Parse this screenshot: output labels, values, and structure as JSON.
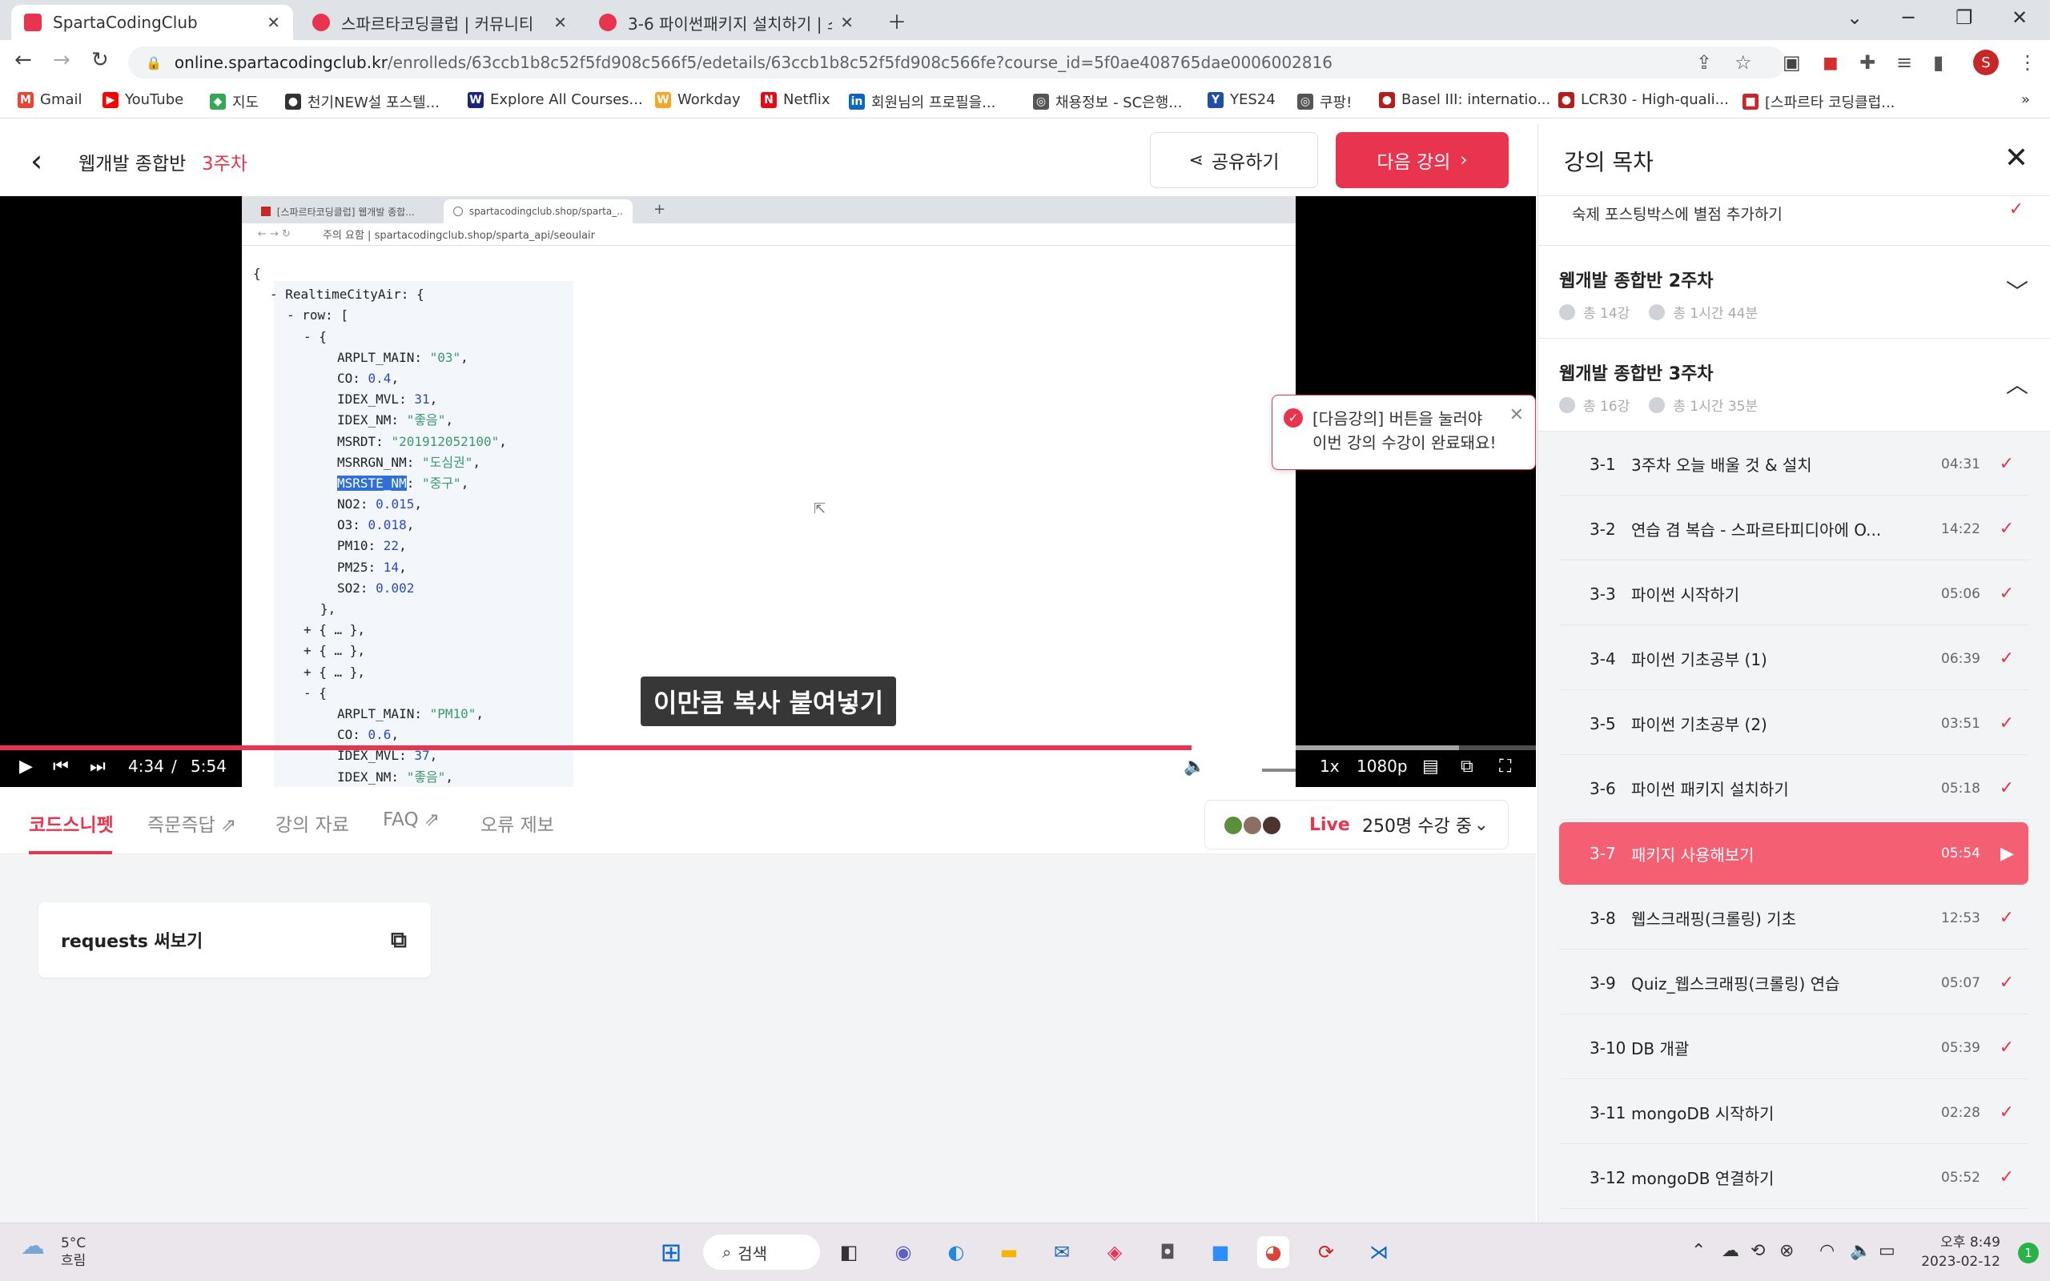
{
  "browser": {
    "tabs": [
      {
        "title": "SpartaCodingClub",
        "color": "#e8344e"
      },
      {
        "title": "스파르타코딩클럽 | 커뮤니티",
        "color": "#e8344e"
      },
      {
        "title": "3-6 파이썬패키지 설치하기 | 스파",
        "color": "#e8344e"
      }
    ],
    "url_host": "online.spartacodingclub.kr",
    "url_path": "/enrolleds/63ccb1b8c52f5fd908c566f5/edetails/63ccb1b8c52f5fd908c566fe?course_id=5f0ae408765dae0006002816",
    "profile_letter": "S"
  },
  "bookmarks": [
    {
      "label": "Gmail",
      "icon": "gmail-icon",
      "color": "#ea4335",
      "glyph": "M"
    },
    {
      "label": "YouTube",
      "icon": "youtube-icon",
      "color": "#ff0000",
      "glyph": "▶"
    },
    {
      "label": "지도",
      "icon": "maps-icon",
      "color": "#34a853",
      "glyph": "◆"
    },
    {
      "label": "천기NEW설 포스텔...",
      "icon": "globe-icon",
      "color": "#333333",
      "glyph": "●"
    },
    {
      "label": "Explore All Courses...",
      "icon": "course-icon",
      "color": "#1a237e",
      "glyph": "W"
    },
    {
      "label": "Workday",
      "icon": "workday-icon",
      "color": "#f5a623",
      "glyph": "W"
    },
    {
      "label": "Netflix",
      "icon": "netflix-icon",
      "color": "#e50914",
      "glyph": "N"
    },
    {
      "label": "회원님의 프로필을...",
      "icon": "linkedin-icon",
      "color": "#0a66c2",
      "glyph": "in"
    },
    {
      "label": "채용정보 - SC은행...",
      "icon": "globe-icon",
      "color": "#555555",
      "glyph": "◎"
    },
    {
      "label": "YES24",
      "icon": "yes24-icon",
      "color": "#1e4fa3",
      "glyph": "Y"
    },
    {
      "label": "쿠팡!",
      "icon": "globe-icon",
      "color": "#555555",
      "glyph": "◎"
    },
    {
      "label": "Basel III: internatio...",
      "icon": "bis-icon",
      "color": "#b71c1c",
      "glyph": "●"
    },
    {
      "label": "LCR30 - High-quali...",
      "icon": "bis-icon",
      "color": "#b71c1c",
      "glyph": "●"
    },
    {
      "label": "[스파르타 코딩클럽...",
      "icon": "sparta-icon",
      "color": "#c62828",
      "glyph": "■"
    }
  ],
  "header": {
    "course": "웹개발 종합반",
    "week": "3주차",
    "share_label": "공유하기",
    "next_label": "다음 강의"
  },
  "video": {
    "inner_tabs": [
      "[스파르타코딩클럽] 웹개발 종합...",
      "spartacodingclub.shop/sparta_..."
    ],
    "inner_url": "주의 요함 | spartacodingclub.shop/sparta_api/seoulair",
    "json_lines": [
      {
        "indent": 0,
        "parts": [
          [
            "k",
            "{"
          ]
        ]
      },
      {
        "indent": 1,
        "parts": [
          [
            "k",
            "- RealtimeCityAir: {"
          ]
        ]
      },
      {
        "indent": 2,
        "parts": [
          [
            "k",
            "- row: ["
          ]
        ]
      },
      {
        "indent": 3,
        "parts": [
          [
            "k",
            "- {"
          ]
        ]
      },
      {
        "indent": 5,
        "parts": [
          [
            "k",
            "ARPLT_MAIN: "
          ],
          [
            "s",
            "\"03\""
          ],
          [
            "k",
            ","
          ]
        ]
      },
      {
        "indent": 5,
        "parts": [
          [
            "k",
            "CO: "
          ],
          [
            "n",
            "0.4"
          ],
          [
            "k",
            ","
          ]
        ]
      },
      {
        "indent": 5,
        "parts": [
          [
            "k",
            "IDEX_MVL: "
          ],
          [
            "n",
            "31"
          ],
          [
            "k",
            ","
          ]
        ]
      },
      {
        "indent": 5,
        "parts": [
          [
            "k",
            "IDEX_NM: "
          ],
          [
            "s",
            "\"좋음\""
          ],
          [
            "k",
            ","
          ]
        ]
      },
      {
        "indent": 5,
        "parts": [
          [
            "k",
            "MSRDT: "
          ],
          [
            "s",
            "\"201912052100\""
          ],
          [
            "k",
            ","
          ]
        ]
      },
      {
        "indent": 5,
        "parts": [
          [
            "k",
            "MSRRGN_NM: "
          ],
          [
            "s",
            "\"도심권\""
          ],
          [
            "k",
            ","
          ]
        ]
      },
      {
        "indent": 5,
        "parts": [
          [
            "sel",
            "MSRSTE_NM"
          ],
          [
            "k",
            ": "
          ],
          [
            "s",
            "\"중구\""
          ],
          [
            "k",
            ","
          ]
        ]
      },
      {
        "indent": 5,
        "parts": [
          [
            "k",
            "NO2: "
          ],
          [
            "n",
            "0.015"
          ],
          [
            "k",
            ","
          ]
        ]
      },
      {
        "indent": 5,
        "parts": [
          [
            "k",
            "O3: "
          ],
          [
            "n",
            "0.018"
          ],
          [
            "k",
            ","
          ]
        ]
      },
      {
        "indent": 5,
        "parts": [
          [
            "k",
            "PM10: "
          ],
          [
            "n",
            "22"
          ],
          [
            "k",
            ","
          ]
        ]
      },
      {
        "indent": 5,
        "parts": [
          [
            "k",
            "PM25: "
          ],
          [
            "n",
            "14"
          ],
          [
            "k",
            ","
          ]
        ]
      },
      {
        "indent": 5,
        "parts": [
          [
            "k",
            "SO2: "
          ],
          [
            "n",
            "0.002"
          ]
        ]
      },
      {
        "indent": 4,
        "parts": [
          [
            "k",
            "},"
          ]
        ]
      },
      {
        "indent": 3,
        "parts": [
          [
            "k",
            "+ { … },"
          ]
        ]
      },
      {
        "indent": 3,
        "parts": [
          [
            "k",
            "+ { … },"
          ]
        ]
      },
      {
        "indent": 3,
        "parts": [
          [
            "k",
            "+ { … },"
          ]
        ]
      },
      {
        "indent": 3,
        "parts": [
          [
            "k",
            "- {"
          ]
        ]
      },
      {
        "indent": 5,
        "parts": [
          [
            "k",
            "ARPLT_MAIN: "
          ],
          [
            "s",
            "\"PM10\""
          ],
          [
            "k",
            ","
          ]
        ]
      },
      {
        "indent": 5,
        "parts": [
          [
            "k",
            "CO: "
          ],
          [
            "n",
            "0.6"
          ],
          [
            "k",
            ","
          ]
        ]
      },
      {
        "indent": 5,
        "parts": [
          [
            "k",
            "IDEX_MVL: "
          ],
          [
            "n",
            "37"
          ],
          [
            "k",
            ","
          ]
        ]
      },
      {
        "indent": 5,
        "parts": [
          [
            "k",
            "IDEX_NM: "
          ],
          [
            "s",
            "\"좋음\""
          ],
          [
            "k",
            ","
          ]
        ]
      }
    ],
    "toast_line1": "[다음강의] 버튼을 눌러야",
    "toast_line2": "이번 강의 수강이 완료돼요!",
    "caption": "이만큼 복사 붙여넣기",
    "current_time": "4:34",
    "separator": "/",
    "duration": "5:54",
    "progress": 0.776,
    "buffered": 0.95,
    "volume": 0.6,
    "speed": "1x",
    "quality": "1080p"
  },
  "bottom_tabs": [
    "코드스니펫",
    "즉문즉답",
    "강의 자료",
    "FAQ",
    "오류 제보"
  ],
  "live": {
    "label": "Live",
    "count": "250명 수강 중"
  },
  "snippet": {
    "title": "requests 써보기"
  },
  "sidebar": {
    "title": "강의 목차",
    "top_item": "숙제   포스팅박스에 별점 추가하기",
    "sections": [
      {
        "title": "웹개발 종합반 2주차",
        "lectures": "총 14강",
        "time": "총 1시간 44분",
        "chevron": "﹀"
      },
      {
        "title": "웹개발 종합반 3주차",
        "lectures": "총 16강",
        "time": "총 1시간 35분",
        "chevron": "︿"
      }
    ],
    "items": [
      {
        "num": "3-1",
        "label": "3주차 오늘 배울 것 & 설치",
        "dur": "04:31",
        "mark": "✓"
      },
      {
        "num": "3-2",
        "label": "연습 겸 복습 - 스파르타피디아에 O...",
        "dur": "14:22",
        "mark": "✓"
      },
      {
        "num": "3-3",
        "label": "파이썬 시작하기",
        "dur": "05:06",
        "mark": "✓"
      },
      {
        "num": "3-4",
        "label": "파이썬 기초공부 (1)",
        "dur": "06:39",
        "mark": "✓"
      },
      {
        "num": "3-5",
        "label": "파이썬 기초공부 (2)",
        "dur": "03:51",
        "mark": "✓"
      },
      {
        "num": "3-6",
        "label": "파이썬 패키지 설치하기",
        "dur": "05:18",
        "mark": "✓"
      },
      {
        "num": "3-7",
        "label": "패키지 사용해보기",
        "dur": "05:54",
        "mark": "▶"
      },
      {
        "num": "3-8",
        "label": "웹스크래핑(크롤링) 기초",
        "dur": "12:53",
        "mark": "✓"
      },
      {
        "num": "3-9",
        "label": "Quiz_웹스크래핑(크롤링) 연습",
        "dur": "05:07",
        "mark": "✓"
      },
      {
        "num": "3-10",
        "label": "DB 개괄",
        "dur": "05:39",
        "mark": "✓"
      },
      {
        "num": "3-11",
        "label": "mongoDB 시작하기",
        "dur": "02:28",
        "mark": "✓"
      },
      {
        "num": "3-12",
        "label": "mongoDB 연결하기",
        "dur": "05:52",
        "mark": "✓"
      }
    ],
    "current_index": 6
  },
  "taskbar": {
    "weather_temp": "5°C",
    "weather_desc": "흐림",
    "search_label": "검색",
    "time": "오후 8:49",
    "date": "2023-02-12",
    "notif_count": "1"
  }
}
